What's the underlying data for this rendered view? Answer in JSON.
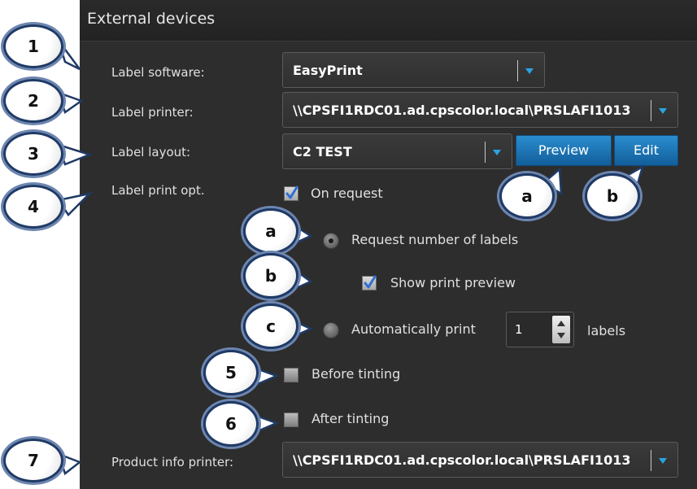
{
  "panel": {
    "title": "External devices"
  },
  "fields": {
    "label_software": {
      "label": "Label software:",
      "value": "EasyPrint"
    },
    "label_printer": {
      "label": "Label printer:",
      "value": "\\\\CPSFI1RDC01.ad.cpscolor.local\\PRSLAFI1013"
    },
    "label_layout": {
      "label": "Label layout:",
      "value": "C2 TEST"
    },
    "label_print_opt": {
      "label": "Label print opt."
    },
    "product_info_printer": {
      "label": "Product info printer:",
      "value": "\\\\CPSFI1RDC01.ad.cpscolor.local\\PRSLAFI1013"
    }
  },
  "buttons": {
    "preview": "Preview",
    "edit": "Edit"
  },
  "options": {
    "on_request": {
      "label": "On request",
      "checked": true
    },
    "request_number": {
      "label": "Request number of labels",
      "selected": true
    },
    "show_preview": {
      "label": "Show print preview",
      "checked": true
    },
    "auto_print": {
      "label": "Automatically print",
      "selected": false,
      "count": "1",
      "suffix": "labels"
    },
    "before_tinting": {
      "label": "Before tinting",
      "checked": false
    },
    "after_tinting": {
      "label": "After tinting",
      "checked": false
    }
  },
  "callouts": {
    "n1": "1",
    "n2": "2",
    "n3": "3",
    "n4": "4",
    "n5": "5",
    "n6": "6",
    "n7": "7",
    "a_buttons": "a",
    "b_buttons": "b",
    "a_options": "a",
    "b_options": "b",
    "c_options": "c"
  },
  "colors": {
    "panel": "#2d2d2d",
    "accent": "#2aa5e0",
    "button": "#1a6fb0",
    "callout_border": "#1f3a66"
  }
}
